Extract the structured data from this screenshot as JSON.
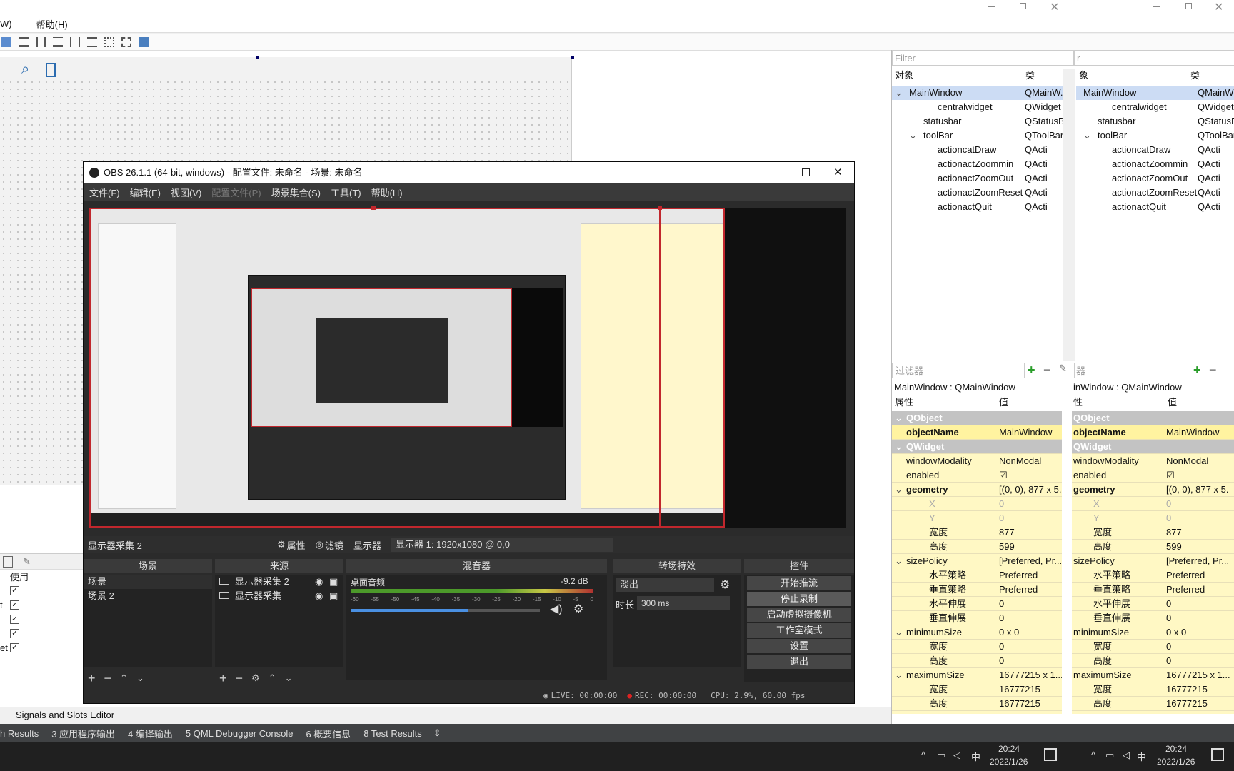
{
  "qt_menu": {
    "left_partial": "W)",
    "help": "帮助(H)"
  },
  "right_filter": {
    "placeholder": "Filter",
    "col_object": "对象",
    "col_class": "类"
  },
  "tree_left": [
    {
      "name": "MainWindow",
      "cls": "QMainW...",
      "indent": 0,
      "sel": true,
      "exp": "v"
    },
    {
      "name": "centralwidget",
      "cls": "QWidget",
      "indent": 2,
      "icon": "widget"
    },
    {
      "name": "statusbar",
      "cls": "QStatusB",
      "indent": 1
    },
    {
      "name": "toolBar",
      "cls": "QToolBar",
      "indent": 1,
      "exp": "v"
    },
    {
      "name": "actioncatDraw",
      "cls": "QActi",
      "indent": 2
    },
    {
      "name": "actionactZoommin",
      "cls": "QActi",
      "indent": 2
    },
    {
      "name": "actionactZoomOut",
      "cls": "QActi",
      "indent": 2
    },
    {
      "name": "actionactZoomReset",
      "cls": "QActi",
      "indent": 2
    },
    {
      "name": "actionactQuit",
      "cls": "QActi",
      "indent": 2
    }
  ],
  "tree_right": [
    {
      "name": "MainWindow",
      "cls": "QMainW..",
      "indent": 0,
      "sel": true
    },
    {
      "name": "centralwidget",
      "cls": "QWidget",
      "indent": 2
    },
    {
      "name": "statusbar",
      "cls": "QStatusB",
      "indent": 1
    },
    {
      "name": "toolBar",
      "cls": "QToolBar",
      "indent": 1,
      "exp": "v"
    },
    {
      "name": "actioncatDraw",
      "cls": "QActi",
      "indent": 2
    },
    {
      "name": "actionactZoommin",
      "cls": "QActi",
      "indent": 2
    },
    {
      "name": "actionactZoomOut",
      "cls": "QActi",
      "indent": 2
    },
    {
      "name": "actionactZoomReset",
      "cls": "QActi",
      "indent": 2
    },
    {
      "name": "actionactQuit",
      "cls": "QActi",
      "indent": 2
    }
  ],
  "props_header": {
    "filter_placeholder": "过滤器",
    "filter_right": "器",
    "title": "MainWindow : QMainWindow",
    "title_right": "inWindow : QMainWindow",
    "col_prop": "属性",
    "col_val": "值"
  },
  "props": [
    {
      "k": "QObject",
      "v": "",
      "grp": true
    },
    {
      "k": "objectName",
      "v": "MainWindow",
      "bold": true,
      "hl": true
    },
    {
      "k": "QWidget",
      "v": "",
      "grp": true
    },
    {
      "k": "windowModality",
      "v": "NonModal"
    },
    {
      "k": "enabled",
      "v": "☑"
    },
    {
      "k": "geometry",
      "v": "[(0, 0), 877 x 5...",
      "bold": true,
      "exp": "v"
    },
    {
      "k": "X",
      "v": "0",
      "sub": true,
      "dim": true
    },
    {
      "k": "Y",
      "v": "0",
      "sub": true,
      "dim": true
    },
    {
      "k": "宽度",
      "v": "877",
      "sub": true
    },
    {
      "k": "高度",
      "v": "599",
      "sub": true
    },
    {
      "k": "sizePolicy",
      "v": "[Preferred, Pr...",
      "exp": "v"
    },
    {
      "k": "水平策略",
      "v": "Preferred",
      "sub": true
    },
    {
      "k": "垂直策略",
      "v": "Preferred",
      "sub": true
    },
    {
      "k": "水平伸展",
      "v": "0",
      "sub": true
    },
    {
      "k": "垂直伸展",
      "v": "0",
      "sub": true
    },
    {
      "k": "minimumSize",
      "v": "0 x 0",
      "exp": "v"
    },
    {
      "k": "宽度",
      "v": "0",
      "sub": true
    },
    {
      "k": "高度",
      "v": "0",
      "sub": true
    },
    {
      "k": "maximumSize",
      "v": "16777215 x 1...",
      "exp": "v"
    },
    {
      "k": "宽度",
      "v": "16777215",
      "sub": true
    },
    {
      "k": "高度",
      "v": "16777215",
      "sub": true
    }
  ],
  "props_right_vals": [
    "",
    "MainWindow",
    "",
    "NonModal",
    "☑",
    "[(0, 0), 877 x 5.",
    "0",
    "0",
    "877",
    "599",
    "[Preferred, Pr...",
    "Preferred",
    "Preferred",
    "0",
    "0",
    "0 x 0",
    "0",
    "0",
    "16777215 x 1...",
    "16777215",
    "16777215"
  ],
  "left_panel": {
    "col_use": "使用",
    "marks": [
      "",
      "t",
      "",
      "",
      "et"
    ]
  },
  "signals_tab": "Signals and Slots Editor",
  "output_tabs": [
    "h Results",
    "3 应用程序输出",
    "4 编译输出",
    "5 QML Debugger Console",
    "6 概要信息",
    "8 Test Results"
  ],
  "obs": {
    "title": "OBS 26.1.1 (64-bit, windows) - 配置文件: 未命名 - 场景: 未命名",
    "menu": [
      "文件(F)",
      "编辑(E)",
      "视图(V)",
      "配置文件(P)",
      "场景集合(S)",
      "工具(T)",
      "帮助(H)"
    ],
    "source_label": "显示器采集 2",
    "props_btn": "属性",
    "filter_btn": "滤镜",
    "display_label": "显示器",
    "display_value": "显示器 1: 1920x1080 @ 0,0",
    "docks": {
      "scenes": "场景",
      "sources": "来源",
      "mixer": "混音器",
      "transitions": "转场特效",
      "controls": "控件"
    },
    "scenes": [
      "场景",
      "场景 2"
    ],
    "sources": [
      "显示器采集 2",
      "显示器采集"
    ],
    "mixer_track": "桌面音频",
    "mixer_db": "-9.2 dB",
    "mixer_scale": [
      "-60",
      "-55",
      "-50",
      "-45",
      "-40",
      "-35",
      "-30",
      "-25",
      "-20",
      "-15",
      "-10",
      "-5",
      "0"
    ],
    "volume_level": 0.62,
    "transition": "淡出",
    "duration_label": "时长",
    "duration": "300 ms",
    "controls": [
      "开始推流",
      "停止录制",
      "启动虚拟摄像机",
      "工作室模式",
      "设置",
      "退出"
    ],
    "status_live": "LIVE: 00:00:00",
    "status_rec": "REC: 00:00:00",
    "status_cpu": "CPU: 2.9%, 60.00 fps"
  },
  "taskbar": {
    "ime": "中",
    "time": "20:24",
    "date": "2022/1/26",
    "ime2": "中",
    "time2": "20:24",
    "date2": "2022/1/26"
  }
}
